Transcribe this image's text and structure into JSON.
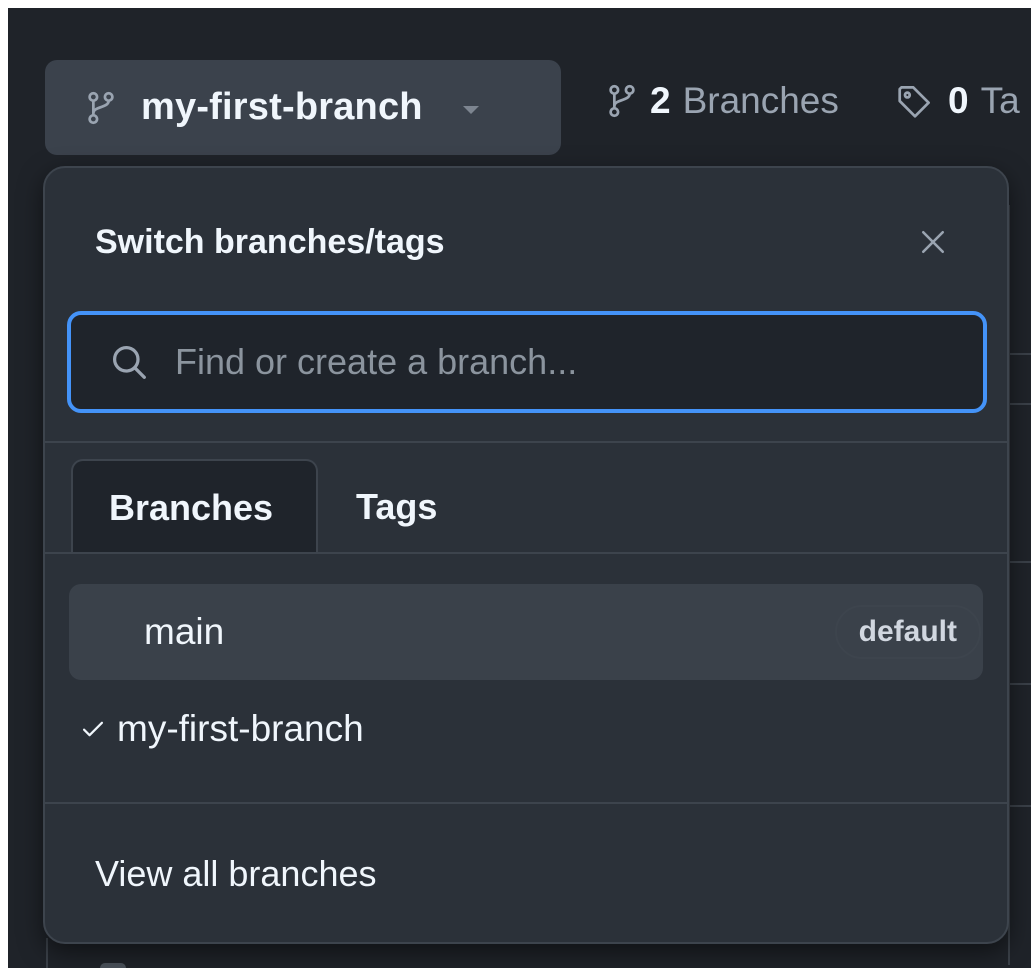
{
  "toolbar": {
    "current_branch": "my-first-branch",
    "branches_count": "2",
    "branches_label": "Branches",
    "tags_count": "0",
    "tags_label": "Ta"
  },
  "dropdown": {
    "title": "Switch branches/tags",
    "search_placeholder": "Find or create a branch...",
    "tabs": [
      {
        "label": "Branches",
        "active": true
      },
      {
        "label": "Tags",
        "active": false
      }
    ],
    "branches": [
      {
        "name": "main",
        "badge": "default",
        "selected": false
      },
      {
        "name": "my-first-branch",
        "badge": "",
        "selected": true
      }
    ],
    "footer_link": "View all branches"
  },
  "colors": {
    "background": "#1f2329",
    "panel": "#2b3139",
    "focus_ring": "#4493f8",
    "text": "#f0f6fc",
    "muted": "#9aa4b1"
  },
  "icons": [
    "git-branch-icon",
    "tag-icon",
    "close-icon",
    "search-icon",
    "check-icon",
    "caret-down-icon"
  ]
}
